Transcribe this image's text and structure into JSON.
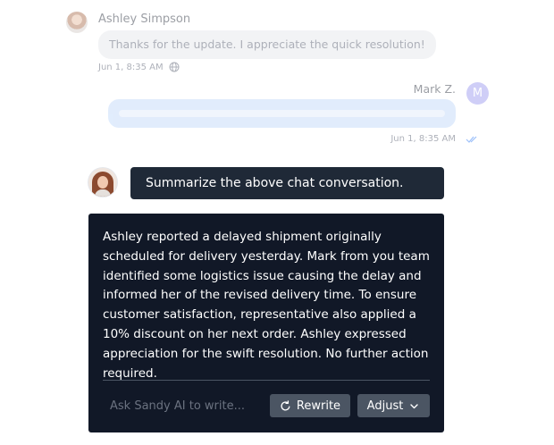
{
  "conversation": {
    "ashley": {
      "name": "Ashley Simpson",
      "message": "Thanks for the update. I appreciate the quick resolution!",
      "timestamp": "Jun 1, 8:35 AM",
      "visibility_icon": "globe-icon"
    },
    "mark": {
      "name": "Mark Z.",
      "avatar_initial": "M",
      "timestamp": "Jun 1, 8:35 AM",
      "status_icon": "double-check-icon"
    }
  },
  "assistant": {
    "prompt": "Summarize the above chat conversation.",
    "response": "Ashley reported a delayed shipment originally scheduled for delivery yesterday. Mark from you team identified some logistics issue causing the delay and informed her of the revised delivery time. To ensure customer satisfaction, representative also applied a 10% discount on her next order. Ashley expressed appreciation for the swift resolution. No further action required.",
    "input_placeholder": "Ask Sandy AI to write...",
    "rewrite_label": "Rewrite",
    "adjust_label": "Adjust"
  },
  "colors": {
    "card_background": "#111827",
    "prompt_background": "#1f2937",
    "button_background": "#4b5563",
    "mark_avatar": "#a9a7f2",
    "mark_bubble": "#c9defb"
  }
}
